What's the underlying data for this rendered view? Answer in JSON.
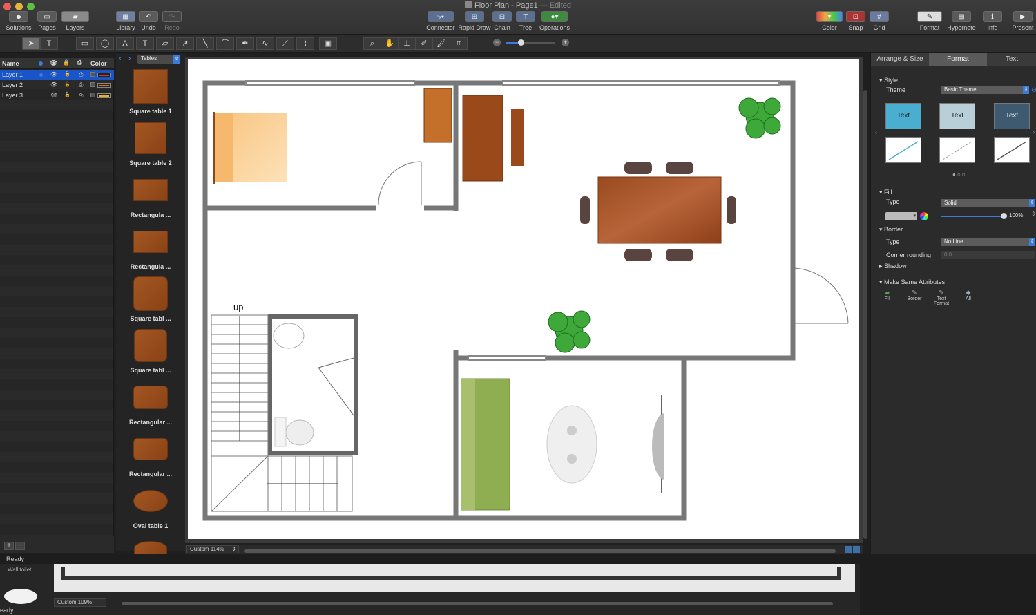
{
  "window": {
    "title": "Floor Plan - Page1",
    "edited": "— Edited"
  },
  "toolbar": {
    "solutions": "Solutions",
    "pages": "Pages",
    "layers": "Layers",
    "library": "Library",
    "undo": "Undo",
    "redo": "Redo",
    "connector": "Connector",
    "rapid_draw": "Rapid Draw",
    "chain": "Chain",
    "tree": "Tree",
    "operations": "Operations",
    "color": "Color",
    "snap": "Snap",
    "grid": "Grid",
    "format": "Format",
    "hypernote": "Hypernote",
    "info": "Info",
    "present": "Present"
  },
  "layers_panel": {
    "headers": {
      "name": "Name",
      "color": "Color"
    },
    "layers": [
      {
        "name": "Layer 1",
        "color": "#d93a2b"
      },
      {
        "name": "Layer 2",
        "color": "#e0781b"
      },
      {
        "name": "Layer 3",
        "color": "#e8b21c"
      }
    ]
  },
  "library": {
    "category": "Tables",
    "items": [
      "Square table 1",
      "Square table 2",
      "Rectangula ...",
      "Rectangula ...",
      "Square tabl ...",
      "Square tabl ...",
      "Rectangular ...",
      "Rectangular ...",
      "Oval table 1"
    ]
  },
  "canvas": {
    "stairs_label": "up"
  },
  "right_panel": {
    "tabs": [
      "Arrange & Size",
      "Format",
      "Text"
    ],
    "style_header": "Style",
    "theme_label": "Theme",
    "theme_value": "Basic Theme",
    "swatch_text": "Text",
    "fill_header": "Fill",
    "fill_type_label": "Type",
    "fill_type_value": "Solid",
    "opacity": "100%",
    "border_header": "Border",
    "border_type_label": "Type",
    "border_type_value": "No Line",
    "corner_label": "Corner rounding",
    "corner_value": "0.0",
    "shadow_label": "Shadow",
    "same_attr_header": "Make Same Attributes",
    "same_attr": [
      "Fill",
      "Border",
      "Text Format",
      "All"
    ]
  },
  "status": {
    "zoom": "Custom 114%",
    "ready": "Ready",
    "back_label": "Wall toilet",
    "back_zoom": "Custom 109%",
    "back_ready": "eady"
  }
}
